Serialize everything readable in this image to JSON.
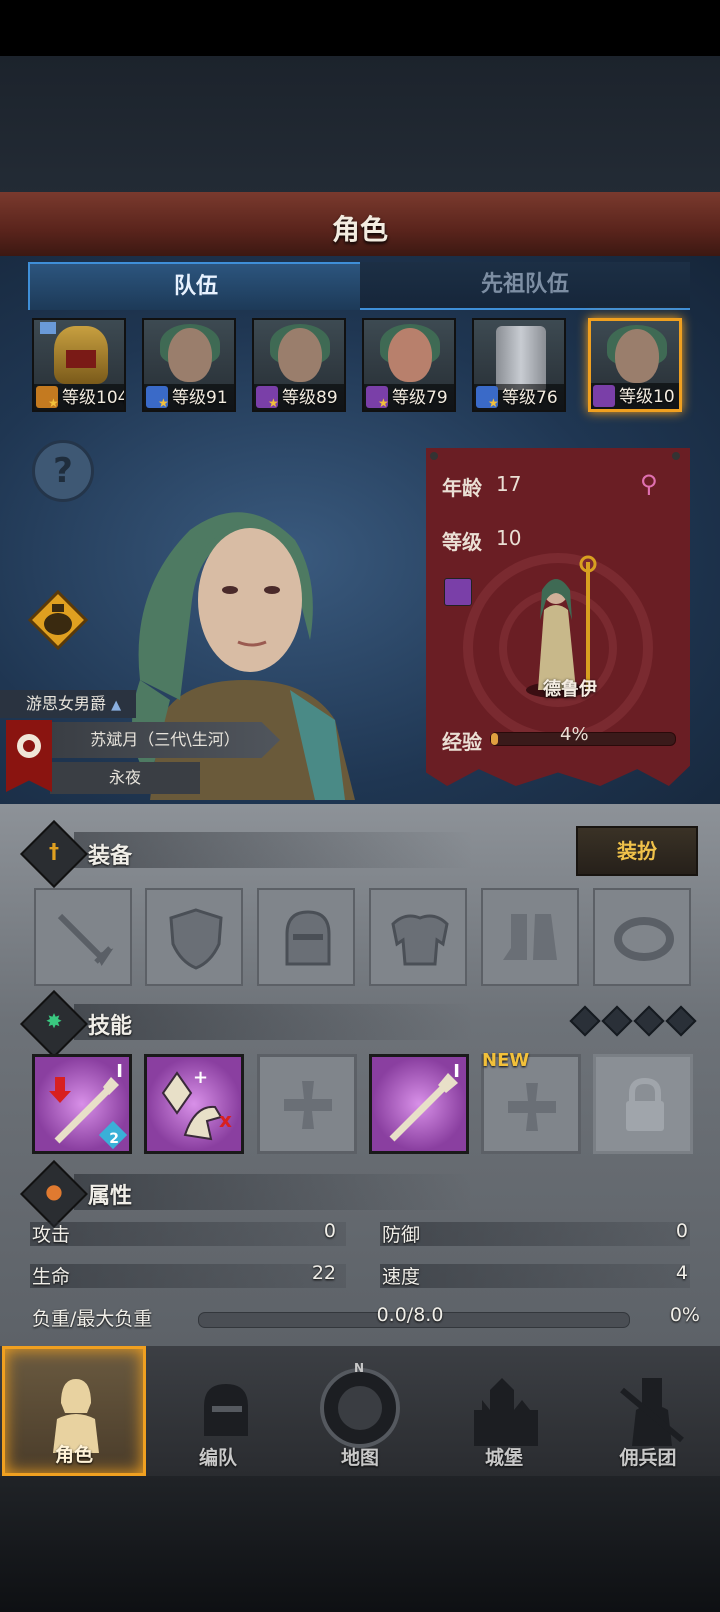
{
  "header": {
    "title": "角色"
  },
  "tabs": {
    "team": "队伍",
    "ancestor_team": "先祖队伍"
  },
  "heroes": [
    {
      "level_label": "等级104",
      "class_color": "#c47a20"
    },
    {
      "level_label": "等级91",
      "class_color": "#3a6ac8"
    },
    {
      "level_label": "等级89",
      "class_color": "#7a3fa8"
    },
    {
      "level_label": "等级79",
      "class_color": "#7a3fa8"
    },
    {
      "level_label": "等级76",
      "class_color": "#3a6ac8"
    },
    {
      "level_label": "等级10",
      "class_color": "#7a3fa8"
    }
  ],
  "character": {
    "title": "游思女男爵",
    "name": "苏斌月（三代\\生河）",
    "dynasty": "永夜",
    "age_label": "年龄",
    "age": "17",
    "level_label": "等级",
    "level": "10",
    "class_name": "德鲁伊",
    "exp_label": "经验",
    "exp_percent": "4%",
    "exp_fraction": 0.04
  },
  "equipment": {
    "title": "装备",
    "dress_button": "装扮",
    "slots": [
      "sword",
      "shield",
      "helmet",
      "armor",
      "boots",
      "ring"
    ]
  },
  "skills": {
    "title": "技能",
    "new_badge": "NEW",
    "roman_1": "I",
    "roman_2": "I",
    "badge_count": "2"
  },
  "attributes": {
    "title": "属性",
    "attack_label": "攻击",
    "attack": "0",
    "defense_label": "防御",
    "defense": "0",
    "life_label": "生命",
    "life": "22",
    "speed_label": "速度",
    "speed": "4",
    "load_label": "负重/最大负重",
    "load": "0.0/8.0",
    "load_percent": "0%"
  },
  "nav": {
    "character": "角色",
    "formation": "编队",
    "map": "地图",
    "castle": "城堡",
    "mercenary": "佣兵团",
    "compass_n": "N"
  }
}
